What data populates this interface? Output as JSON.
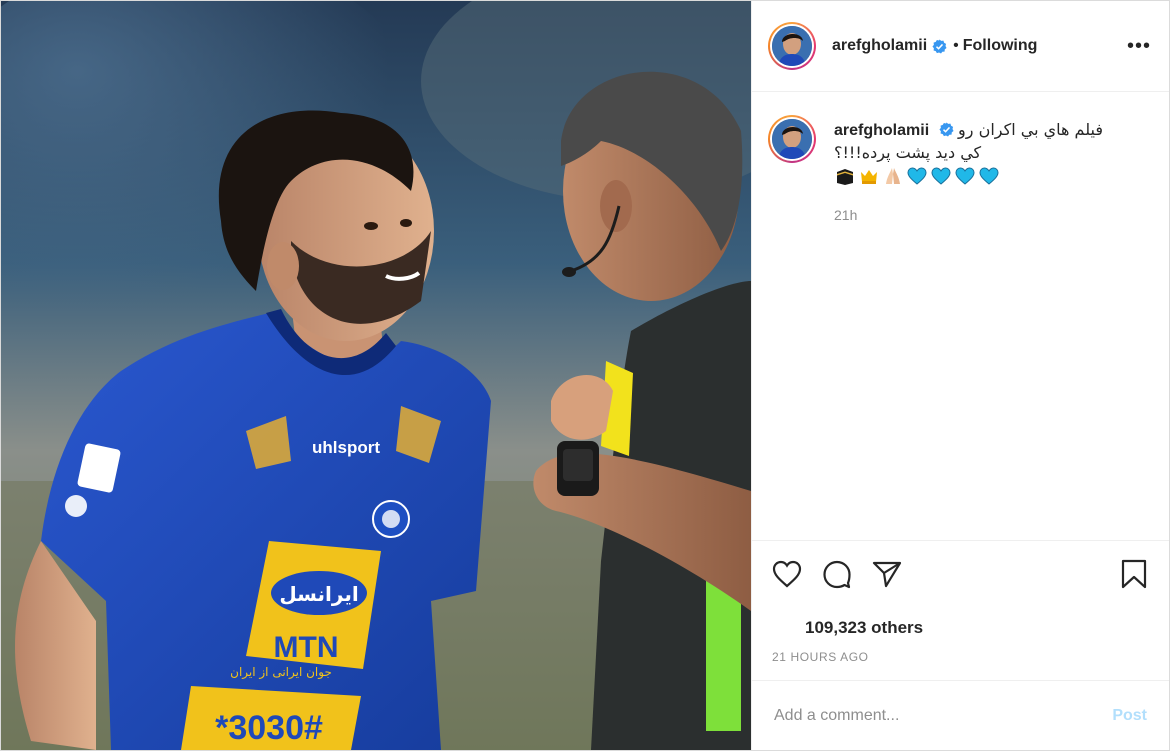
{
  "post": {
    "author": {
      "username": "arefgholamii",
      "verified": true,
      "follow_state": "Following",
      "separator": "•"
    },
    "more_label": "•••",
    "caption": {
      "username": "arefgholamii",
      "line1": "فيلم هاي بي اكران رو",
      "line2": "كي ديد پشت پرده!!!؟",
      "emojis": [
        "kaaba-emoji",
        "crown-emoji",
        "folded-hands-emoji",
        "blue-heart-emoji",
        "blue-heart-emoji",
        "blue-heart-emoji",
        "blue-heart-emoji"
      ]
    },
    "caption_time": "21h",
    "likes": "109,323 others",
    "timestamp": "21 hours ago",
    "comment": {
      "placeholder": "Add a comment...",
      "post_label": "Post"
    },
    "photo": {
      "jersey_sponsor": "ایرانسل",
      "jersey_sponsor_sub": "MTN",
      "jersey_number_text": "*3030#",
      "jersey_brand": "uhlsport",
      "jersey_text": "جوان ایرانی از ایران"
    }
  },
  "colors": {
    "jersey_blue": "#1f49b8",
    "verified_blue": "#3897f0",
    "yellow_card": "#f2e21c",
    "referee_green": "#7ee03a",
    "post_button": "#b2dffc"
  }
}
